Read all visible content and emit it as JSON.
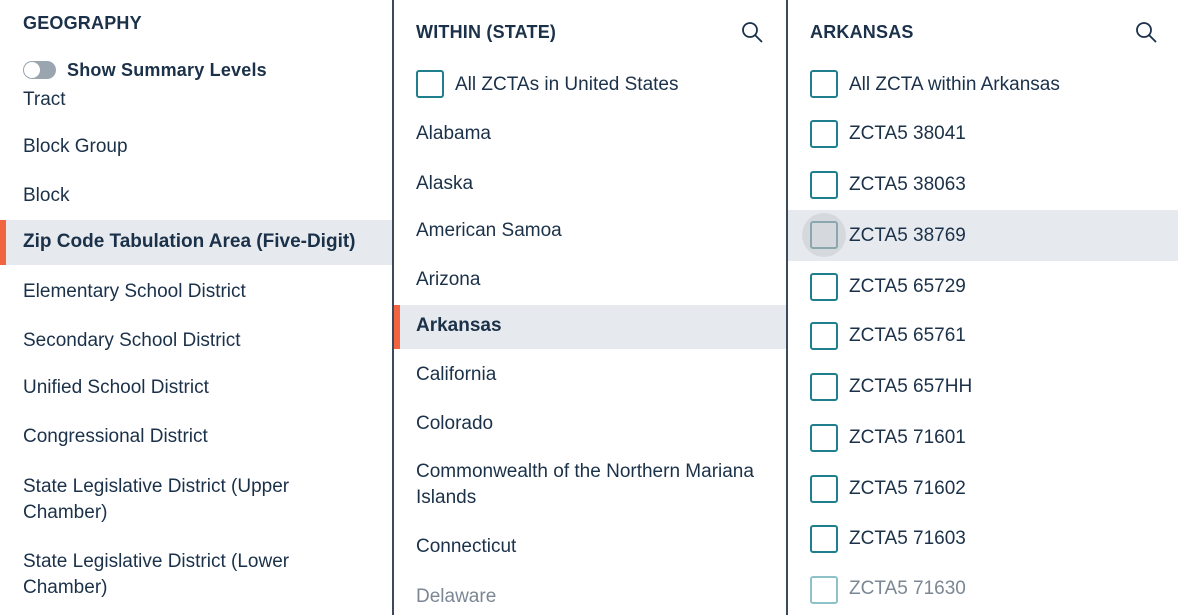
{
  "geography": {
    "header": "GEOGRAPHY",
    "toggle_label": "Show Summary Levels",
    "items": [
      {
        "label": "Tract"
      },
      {
        "label": "Block Group"
      },
      {
        "label": "Block"
      },
      {
        "label": "Zip Code Tabulation Area (Five-Digit)"
      },
      {
        "label": "Elementary School District"
      },
      {
        "label": "Secondary School District"
      },
      {
        "label": "Unified School District"
      },
      {
        "label": "Congressional District"
      },
      {
        "label": "State Legislative District (Upper Chamber)"
      },
      {
        "label": "State Legislative District (Lower Chamber)"
      }
    ]
  },
  "within": {
    "header": "WITHIN (STATE)",
    "all_label": "All ZCTAs in United States",
    "items": [
      {
        "label": "Alabama"
      },
      {
        "label": "Alaska"
      },
      {
        "label": "American Samoa"
      },
      {
        "label": "Arizona"
      },
      {
        "label": "Arkansas"
      },
      {
        "label": "California"
      },
      {
        "label": "Colorado"
      },
      {
        "label": "Commonwealth of the Northern Mariana Islands"
      },
      {
        "label": "Connecticut"
      },
      {
        "label": "Delaware"
      }
    ]
  },
  "arkansas": {
    "header": "ARKANSAS",
    "all_label": "All ZCTA within Arkansas",
    "items": [
      {
        "label": "ZCTA5 38041"
      },
      {
        "label": "ZCTA5 38063"
      },
      {
        "label": "ZCTA5 38769"
      },
      {
        "label": "ZCTA5 65729"
      },
      {
        "label": "ZCTA5 65761"
      },
      {
        "label": "ZCTA5 657HH"
      },
      {
        "label": "ZCTA5 71601"
      },
      {
        "label": "ZCTA5 71602"
      },
      {
        "label": "ZCTA5 71603"
      },
      {
        "label": "ZCTA5 71630"
      }
    ]
  },
  "colors": {
    "accent": "#f26440",
    "selected_bg": "#e6eaee",
    "text": "#1b3149",
    "checkbox": "#1f7f8c"
  }
}
